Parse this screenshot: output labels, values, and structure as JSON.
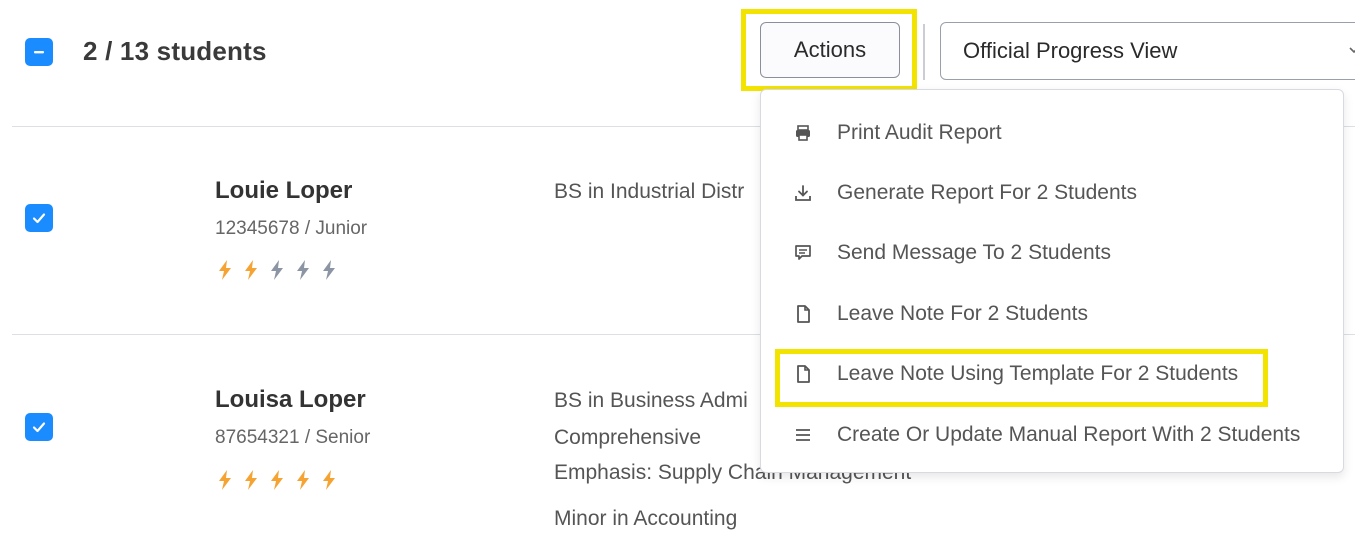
{
  "header": {
    "selection_label": "2 / 13 students",
    "actions_label": "Actions",
    "view_select_value": "Official Progress View"
  },
  "students": [
    {
      "name": "Louie Loper",
      "meta": "12345678  / Junior",
      "rating": 2,
      "rating_max": 5,
      "program": [
        "BS in Industrial Distr"
      ]
    },
    {
      "name": "Louisa Loper",
      "meta": "87654321  / Senior",
      "rating": 5,
      "rating_max": 5,
      "program": [
        "BS in Business Admi",
        "Comprehensive",
        "Emphasis: Supply Chain Management",
        "Minor in Accounting"
      ]
    }
  ],
  "menu": {
    "items": [
      {
        "label": "Print Audit Report",
        "icon": "printer-icon"
      },
      {
        "label": "Generate Report For 2 Students",
        "icon": "download-icon"
      },
      {
        "label": "Send Message To 2 Students",
        "icon": "message-icon"
      },
      {
        "label": "Leave Note For 2 Students",
        "icon": "note-icon"
      },
      {
        "label": "Leave Note Using Template For 2 Students",
        "icon": "note-icon"
      },
      {
        "label": "Create Or Update Manual Report With 2 Students",
        "icon": "list-icon"
      }
    ]
  },
  "colors": {
    "accent": "#1a8cff",
    "highlight": "#f2e300",
    "bolt_active": "#f5a332",
    "bolt_inactive": "#8c95a3"
  }
}
